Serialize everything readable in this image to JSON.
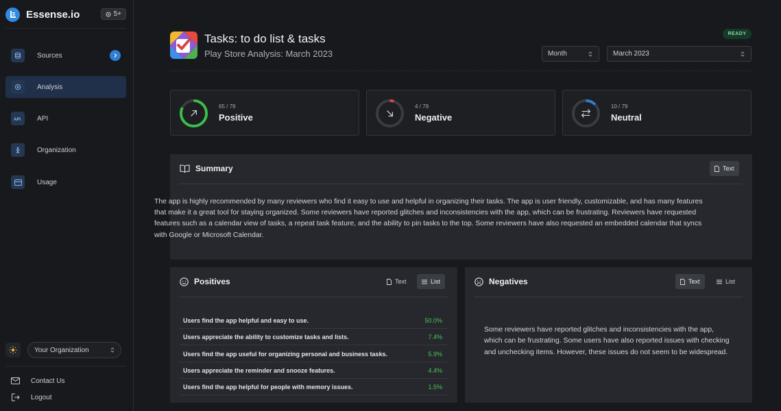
{
  "brand": {
    "name": "Essense.io",
    "badge": "5+"
  },
  "nav": [
    {
      "label": "Sources",
      "icon": "database-icon"
    },
    {
      "label": "Analysis",
      "icon": "target-icon",
      "active": true
    },
    {
      "label": "API",
      "icon": "api-icon"
    },
    {
      "label": "Organization",
      "icon": "person-icon"
    },
    {
      "label": "Usage",
      "icon": "card-icon"
    }
  ],
  "org_select": {
    "value": "Your Organization"
  },
  "bottom_links": {
    "contact": "Contact Us",
    "logout": "Logout"
  },
  "header": {
    "title": "Tasks: to do list & tasks",
    "subtitle": "Play Store Analysis: March 2023",
    "status": "READY",
    "period_select": "Month",
    "month_select": "March 2023"
  },
  "stats": [
    {
      "count": "65 / 79",
      "label": "Positive",
      "fraction": 0.823,
      "color": "#3bbf4a",
      "icon": "arrow-up-right-icon"
    },
    {
      "count": "4 / 79",
      "label": "Negative",
      "fraction": 0.051,
      "color": "#e0453c",
      "icon": "arrow-down-right-icon"
    },
    {
      "count": "10 / 79",
      "label": "Neutral",
      "fraction": 0.127,
      "color": "#2f7fd6",
      "icon": "swap-arrows-icon"
    }
  ],
  "summary": {
    "title": "Summary",
    "text_button": "Text",
    "body": "The app is highly recommended by many reviewers who find it easy to use and helpful in organizing their tasks. The app is user friendly, customizable, and has many features that make it a great tool for staying organized. Some reviewers have reported glitches and inconsistencies with the app, which can be frustrating. Reviewers have requested features such as a calendar view of tasks, a repeat task feature, and the ability to pin tasks to the top. Some reviewers have also requested an embedded calendar that syncs with Google or Microsoft Calendar."
  },
  "positives": {
    "title": "Positives",
    "text_button": "Text",
    "list_button": "List",
    "items": [
      {
        "text": "Users find the app helpful and easy to use.",
        "pct": "50.0%"
      },
      {
        "text": "Users appreciate the ability to customize tasks and lists.",
        "pct": "7.4%"
      },
      {
        "text": "Users find the app useful for organizing personal and business tasks.",
        "pct": "5.9%"
      },
      {
        "text": "Users appreciate the reminder and snooze features.",
        "pct": "4.4%"
      },
      {
        "text": "Users find the app helpful for people with memory issues.",
        "pct": "1.5%"
      }
    ]
  },
  "negatives": {
    "title": "Negatives",
    "text_button": "Text",
    "list_button": "List",
    "body": "Some reviewers have reported glitches and inconsistencies with the app, which can be frustrating. Some users have also reported issues with checking and unchecking items. However, these issues do not seem to be widespread."
  }
}
